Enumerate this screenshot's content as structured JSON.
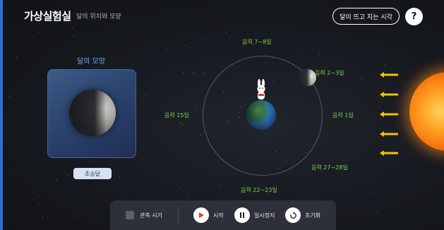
{
  "header": {
    "title": "가상실험실",
    "subtitle": "달의 위치와 모양",
    "rise_set_button": "달이 뜨고 지는 시각",
    "help_button": "?"
  },
  "moon_panel": {
    "title": "달의 모양",
    "phase_label": "초승달"
  },
  "orbit_labels": {
    "top": "음력 7~8일",
    "top_right": "음력 2~3일",
    "right": "음력 1일",
    "bottom_right": "음력 27~28일",
    "bottom": "음력 22~23일",
    "left": "음력 15일"
  },
  "controls": {
    "observe_time_label": "관측 시기",
    "start_label": "시작",
    "pause_label": "일시정지",
    "reset_label": "초기화"
  },
  "colors": {
    "accent_blue": "#6fb6ff",
    "orbit_label_green": "#7dd34f",
    "arrow_yellow": "#f5c400",
    "start_red": "#e53935"
  }
}
